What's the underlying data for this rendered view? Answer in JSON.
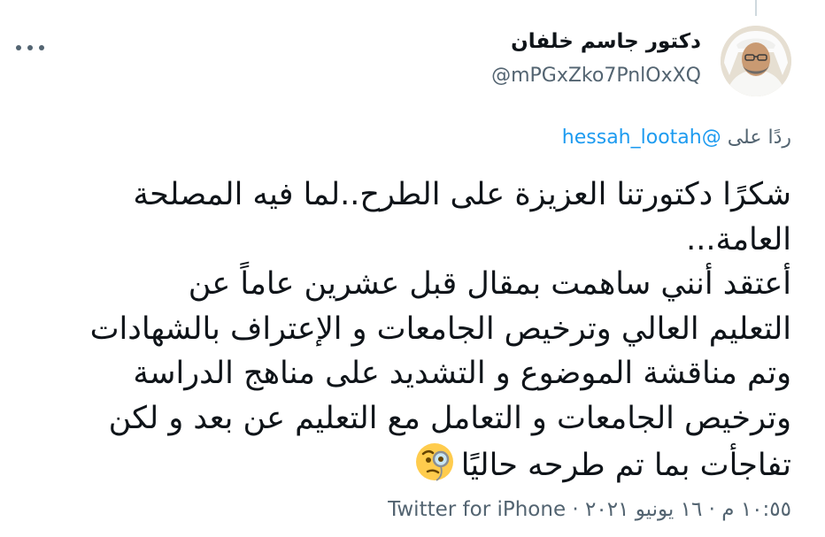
{
  "author": {
    "display_name": "دكتور جاسم خلفان",
    "handle": "@mPGxZko7PnlOxXQ"
  },
  "reply": {
    "prefix": "ردًا على",
    "mention": "@hessah_lootah"
  },
  "tweet": {
    "lines": [
      "شكرًا دكتورتنا العزيزة على الطرح..لما فيه المصلحة",
      "العامة...",
      "أعتقد أنني ساهمت بمقال قبل عشرين عاماً عن",
      "التعليم العالي وترخيص الجامعات و الإعتراف بالشهادات",
      "وتم مناقشة الموضوع و التشديد على مناهج الدراسة",
      "وترخيص الجامعات و التعامل مع التعليم عن بعد و لكن",
      "تفاجأت بما تم طرحه حاليًا"
    ],
    "emoji": "face-with-monocle-icon"
  },
  "meta": {
    "time": "١٠:٥٥ م",
    "separator": " · ",
    "date": "١٦ يونيو ٢٠٢١",
    "app": "Twitter for iPhone"
  },
  "colors": {
    "mention_blue": "#1d9bf0",
    "secondary_text": "#536471",
    "primary_text": "#0f1419"
  }
}
